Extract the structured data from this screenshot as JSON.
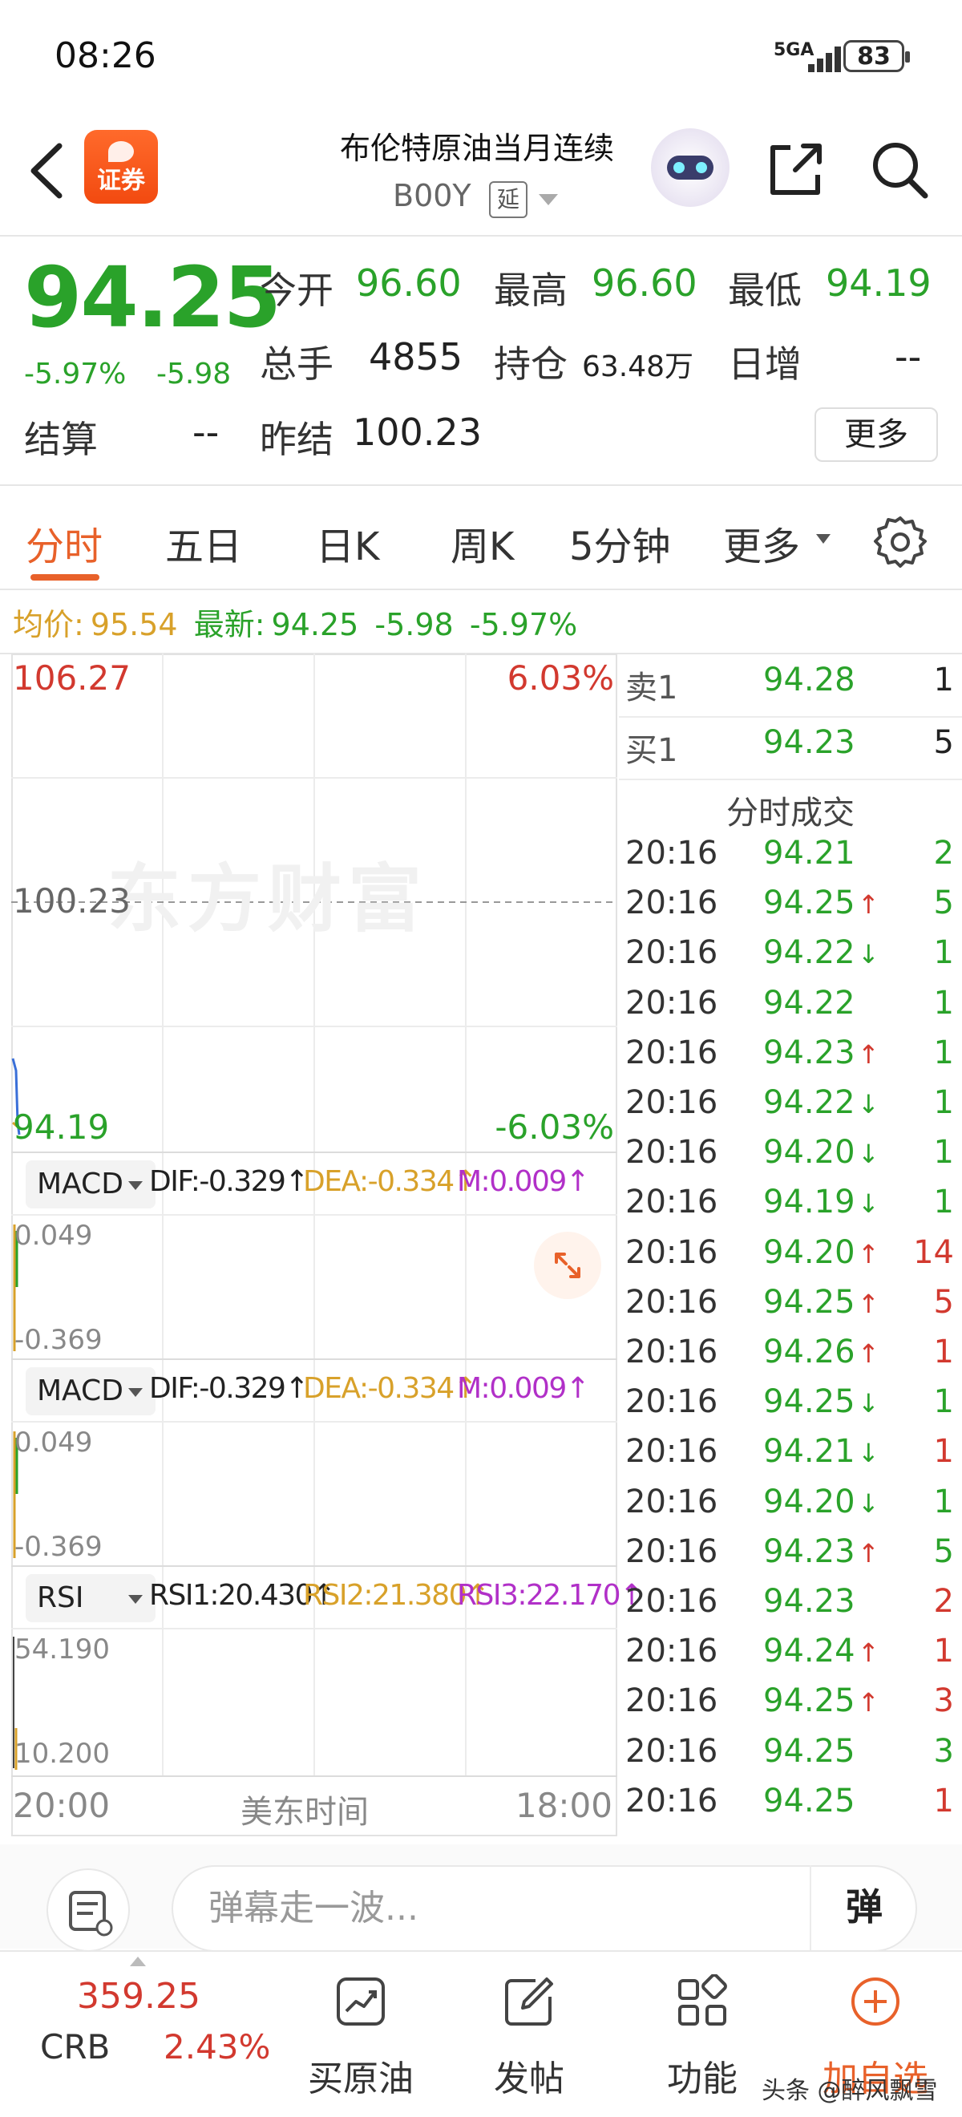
{
  "status_bar": {
    "time": "08:26",
    "network": "5GA",
    "battery": "83"
  },
  "header": {
    "app_badge": "证券",
    "stock_name": "布伦特原油当月连续",
    "stock_code": "B00Y",
    "delay_tag": "延"
  },
  "quote": {
    "price": "94.25",
    "change_pct": "-5.97%",
    "change_abs": "-5.98",
    "open_label": "今开",
    "open": "96.60",
    "high_label": "最高",
    "high": "96.60",
    "low_label": "最低",
    "low": "94.19",
    "volume_label": "总手",
    "volume": "4855",
    "oi_label": "持仓",
    "oi": "63.48万",
    "daily_inc_label": "日增",
    "daily_inc": "--",
    "settle_label": "结算",
    "settle": "--",
    "prev_settle_label": "昨结",
    "prev_settle": "100.23",
    "more_button": "更多"
  },
  "tabs": [
    {
      "label": "分时",
      "active": true
    },
    {
      "label": "五日"
    },
    {
      "label": "日K"
    },
    {
      "label": "周K"
    },
    {
      "label": "5分钟"
    },
    {
      "label": "更多"
    }
  ],
  "info_line": {
    "avg_label": "均价:",
    "avg": "95.54",
    "latest_label": "最新:",
    "latest": "94.25",
    "change": "-5.98",
    "change_pct": "-5.97%"
  },
  "chart": {
    "y_max": "106.27",
    "y_max_pct": "6.03%",
    "ref_line": "100.23",
    "y_min": "94.19",
    "y_min_pct": "-6.03%",
    "watermark": "东方财富",
    "x_start": "20:00",
    "x_mid": "美东时间",
    "x_end": "18:00",
    "icon_colors": {
      "up": "#d2392f",
      "down": "#2aa22a",
      "avg": "#d8a12a",
      "price": "#3a6fd8"
    }
  },
  "indicators": [
    {
      "name": "MACD",
      "dif": "DIF:-0.329↑",
      "dea": "DEA:-0.334↑",
      "m": "M:0.009↑",
      "top": "0.049",
      "bottom": "-0.369"
    },
    {
      "name": "MACD",
      "dif": "DIF:-0.329↑",
      "dea": "DEA:-0.334↑",
      "m": "M:0.009↑",
      "top": "0.049",
      "bottom": "-0.369"
    },
    {
      "name": "RSI",
      "dif": "RSI1:20.430↑",
      "dea": "RSI2:21.380↑",
      "m": "RSI3:22.170↑",
      "top": "54.190",
      "bottom": "10.200"
    }
  ],
  "order_book": {
    "sell1": {
      "label": "卖1",
      "price": "94.28",
      "vol": "1"
    },
    "buy1": {
      "label": "买1",
      "price": "94.23",
      "vol": "5"
    },
    "title": "分时成交"
  },
  "trades": [
    {
      "time": "20:16",
      "price": "94.21",
      "arrow": "",
      "vol": "2",
      "dir": "down"
    },
    {
      "time": "20:16",
      "price": "94.25",
      "arrow": "↑",
      "vol": "5",
      "dir": "down"
    },
    {
      "time": "20:16",
      "price": "94.22",
      "arrow": "↓",
      "vol": "1",
      "dir": "down"
    },
    {
      "time": "20:16",
      "price": "94.22",
      "arrow": "",
      "vol": "1",
      "dir": "down"
    },
    {
      "time": "20:16",
      "price": "94.23",
      "arrow": "↑",
      "vol": "1",
      "dir": "down"
    },
    {
      "time": "20:16",
      "price": "94.22",
      "arrow": "↓",
      "vol": "1",
      "dir": "down"
    },
    {
      "time": "20:16",
      "price": "94.20",
      "arrow": "↓",
      "vol": "1",
      "dir": "down"
    },
    {
      "time": "20:16",
      "price": "94.19",
      "arrow": "↓",
      "vol": "1",
      "dir": "down"
    },
    {
      "time": "20:16",
      "price": "94.20",
      "arrow": "↑",
      "vol": "14",
      "dir": "up"
    },
    {
      "time": "20:16",
      "price": "94.25",
      "arrow": "↑",
      "vol": "5",
      "dir": "up"
    },
    {
      "time": "20:16",
      "price": "94.26",
      "arrow": "↑",
      "vol": "1",
      "dir": "up"
    },
    {
      "time": "20:16",
      "price": "94.25",
      "arrow": "↓",
      "vol": "1",
      "dir": "down"
    },
    {
      "time": "20:16",
      "price": "94.21",
      "arrow": "↓",
      "vol": "1",
      "dir": "up"
    },
    {
      "time": "20:16",
      "price": "94.20",
      "arrow": "↓",
      "vol": "1",
      "dir": "down"
    },
    {
      "time": "20:16",
      "price": "94.23",
      "arrow": "↑",
      "vol": "5",
      "dir": "down"
    },
    {
      "time": "20:16",
      "price": "94.23",
      "arrow": "",
      "vol": "2",
      "dir": "up"
    },
    {
      "time": "20:16",
      "price": "94.24",
      "arrow": "↑",
      "vol": "1",
      "dir": "up"
    },
    {
      "time": "20:16",
      "price": "94.25",
      "arrow": "↑",
      "vol": "3",
      "dir": "up"
    },
    {
      "time": "20:16",
      "price": "94.25",
      "arrow": "",
      "vol": "3",
      "dir": "down"
    },
    {
      "time": "20:16",
      "price": "94.25",
      "arrow": "",
      "vol": "1",
      "dir": "up"
    }
  ],
  "comment_bar": {
    "placeholder": "弹幕走一波...",
    "danmu_button": "弹"
  },
  "bottom_nav": {
    "crb_price": "359.25",
    "crb_name": "CRB",
    "crb_pct": "2.43%",
    "items": [
      {
        "label": "买原油",
        "icon": "chart-up-icon"
      },
      {
        "label": "发帖",
        "icon": "edit-icon"
      },
      {
        "label": "功能",
        "icon": "grid-icon"
      },
      {
        "label": "加自选",
        "icon": "add-circle-icon"
      }
    ],
    "author_mark": "头条 @醉风飘雪"
  }
}
